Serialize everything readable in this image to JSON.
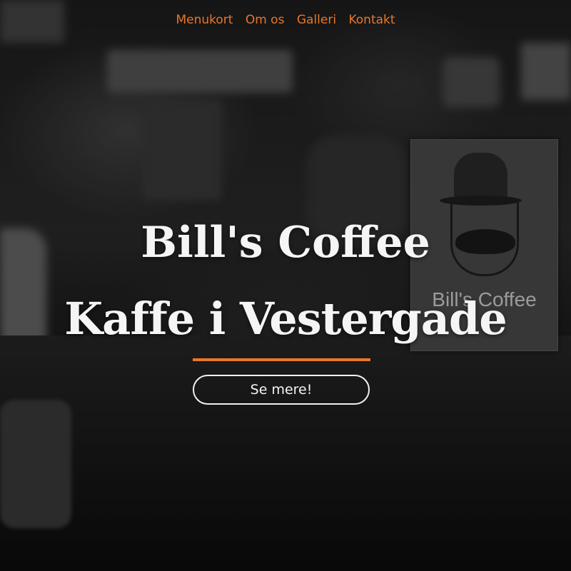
{
  "nav": {
    "items": [
      {
        "label": "Menukort"
      },
      {
        "label": "Om os"
      },
      {
        "label": "Galleri"
      },
      {
        "label": "Kontakt"
      }
    ]
  },
  "hero": {
    "title_line1": "Bill's Coffee",
    "title_line2": "Kaffe i Vestergade",
    "cta_label": "Se mere!",
    "card_text": "Bill's Coffee"
  },
  "colors": {
    "accent": "#e8772b",
    "title": "#f5f5f5"
  }
}
